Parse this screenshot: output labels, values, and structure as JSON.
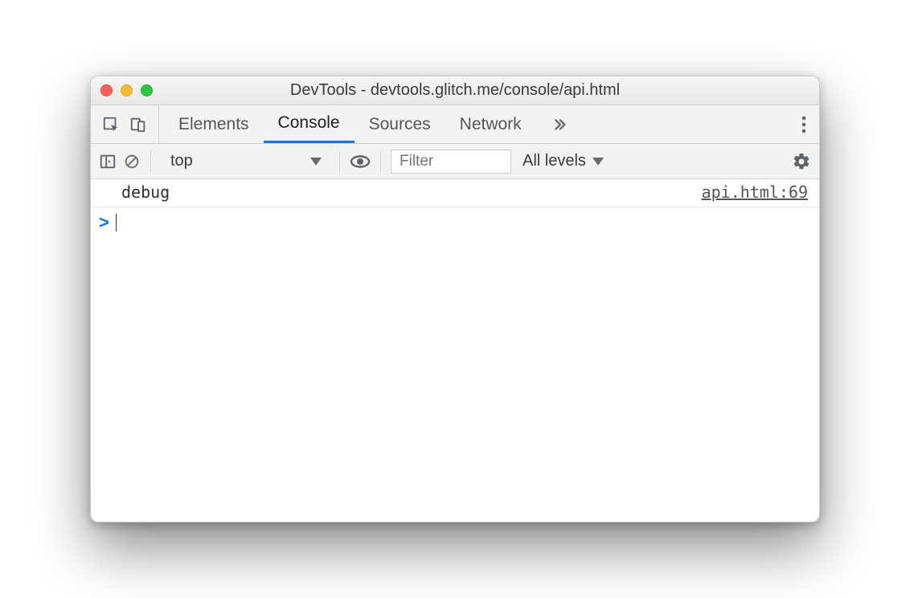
{
  "window": {
    "title": "DevTools - devtools.glitch.me/console/api.html"
  },
  "tabs": {
    "items": [
      "Elements",
      "Console",
      "Sources",
      "Network"
    ],
    "active_index": 1
  },
  "filterbar": {
    "context": "top",
    "filter_placeholder": "Filter",
    "levels_label": "All levels"
  },
  "console": {
    "logs": [
      {
        "message": "debug",
        "source": "api.html:69"
      }
    ],
    "prompt": ">"
  }
}
